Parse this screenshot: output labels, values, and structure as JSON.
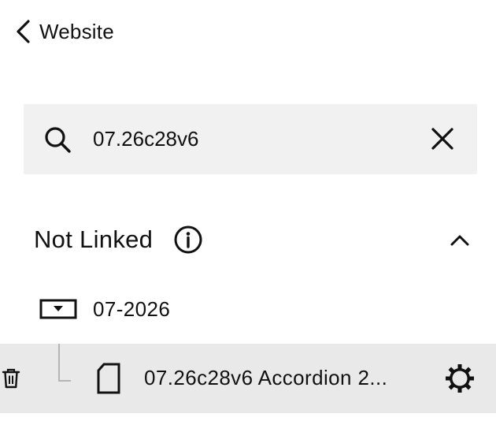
{
  "nav": {
    "back_label": "Website",
    "back_icon": "chevron-left-icon"
  },
  "search": {
    "value": "07.26c28v6",
    "icon": "search-icon",
    "clear_icon": "close-icon"
  },
  "section": {
    "title": "Not Linked",
    "info_icon": "info-icon",
    "toggle_icon": "chevron-up-icon",
    "expanded": true
  },
  "folder": {
    "label": "07-2026",
    "icon": "folder-dropdown-icon"
  },
  "page": {
    "label": "07.26c28v6 Accordion 2...",
    "icon": "page-icon",
    "delete_icon": "trash-icon",
    "settings_icon": "gear-icon",
    "selected": true
  },
  "colors": {
    "text": "#111111",
    "search_bg": "#f1f1f1",
    "selected_row_bg": "#e9e9e9",
    "tree_line": "#b5b5b5"
  }
}
